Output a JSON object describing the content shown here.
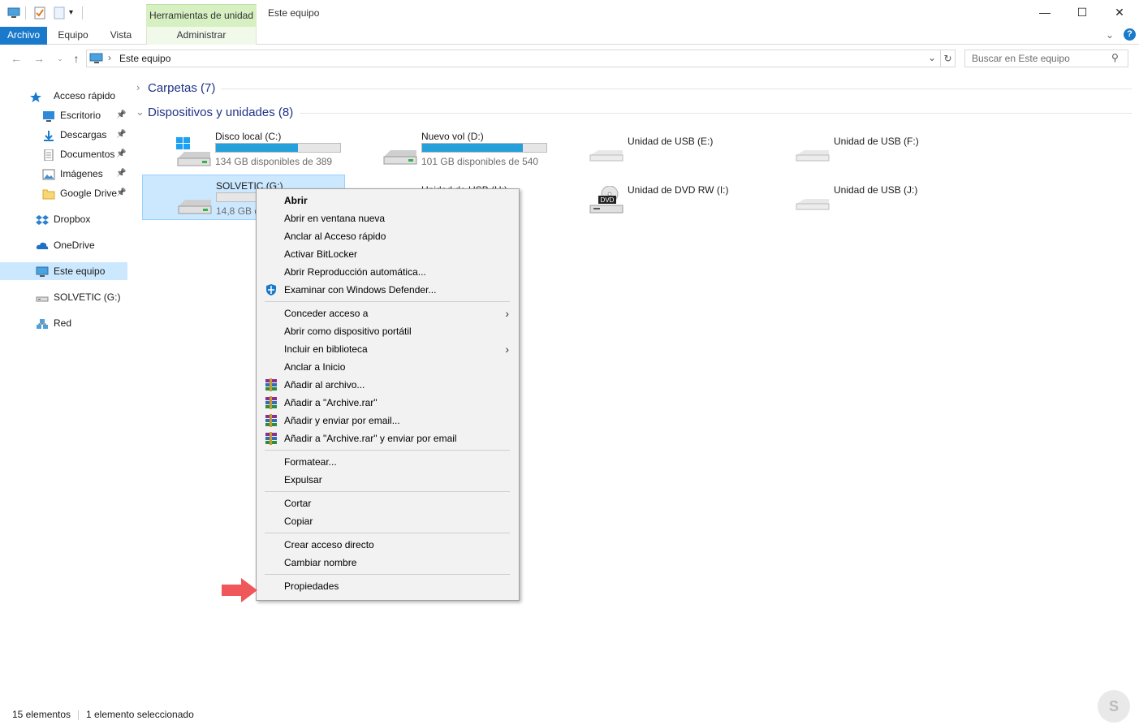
{
  "window": {
    "title": "Este equipo",
    "contextual_tab_group": "Herramientas de unidad",
    "controls": {
      "minimize": "—",
      "maximize": "☐",
      "close": "✕"
    }
  },
  "ribbon": {
    "tabs": [
      "Archivo",
      "Equipo",
      "Vista"
    ],
    "contextual_tab": "Administrar"
  },
  "address_bar": {
    "location": "Este equipo",
    "search_placeholder": "Buscar en Este equipo"
  },
  "nav_pane": {
    "items": [
      {
        "label": "Acceso rápido",
        "icon": "star-icon"
      },
      {
        "label": "Escritorio",
        "icon": "desktop-icon",
        "pinned": true
      },
      {
        "label": "Descargas",
        "icon": "download-icon",
        "pinned": true
      },
      {
        "label": "Documentos",
        "icon": "documents-icon",
        "pinned": true
      },
      {
        "label": "Imágenes",
        "icon": "images-icon",
        "pinned": true
      },
      {
        "label": "Google Drive",
        "icon": "folder-icon",
        "pinned": true
      },
      {
        "label": "Dropbox",
        "icon": "dropbox-icon"
      },
      {
        "label": "OneDrive",
        "icon": "cloud-icon"
      },
      {
        "label": "Este equipo",
        "icon": "computer-icon",
        "selected": true
      },
      {
        "label": "SOLVETIC (G:)",
        "icon": "usb-drive-icon"
      },
      {
        "label": "Red",
        "icon": "network-icon"
      }
    ]
  },
  "content": {
    "groups": [
      {
        "title": "Carpetas (7)",
        "expanded": false
      },
      {
        "title": "Dispositivos y unidades (8)",
        "expanded": true
      }
    ],
    "drives": [
      {
        "name": "Disco local (C:)",
        "free": "134 GB disponibles de 389",
        "used_fraction": 0.66,
        "icon": "windows-drive-icon"
      },
      {
        "name": "Nuevo vol (D:)",
        "free": "101 GB disponibles de 540",
        "used_fraction": 0.81,
        "icon": "hard-drive-icon"
      },
      {
        "name": "Unidad de USB (E:)",
        "icon": "usb-drive-icon"
      },
      {
        "name": "Unidad de USB (F:)",
        "icon": "usb-drive-icon"
      },
      {
        "name": "SOLVETIC (G:)",
        "free": "14,8 GB d",
        "used_fraction": 0.0,
        "icon": "hard-drive-icon",
        "selected": true
      },
      {
        "name": "Unidad de USB (H:)",
        "icon": "usb-drive-icon"
      },
      {
        "name": "Unidad de DVD RW (I:)",
        "icon": "dvd-drive-icon",
        "badge": "DVD"
      },
      {
        "name": "Unidad de USB (J:)",
        "icon": "usb-drive-icon"
      }
    ]
  },
  "context_menu": {
    "items": [
      {
        "label": "Abrir",
        "bold": true
      },
      {
        "label": "Abrir en ventana nueva"
      },
      {
        "label": "Anclar al Acceso rápido"
      },
      {
        "label": "Activar BitLocker"
      },
      {
        "label": "Abrir Reproducción automática..."
      },
      {
        "label": "Examinar con Windows Defender...",
        "icon": "defender-icon"
      },
      {
        "sep": true
      },
      {
        "label": "Conceder acceso a",
        "submenu": true
      },
      {
        "label": "Abrir como dispositivo portátil"
      },
      {
        "label": "Incluir en biblioteca",
        "submenu": true
      },
      {
        "label": "Anclar a Inicio"
      },
      {
        "label": "Añadir al archivo...",
        "icon": "winrar-icon"
      },
      {
        "label": "Añadir a \"Archive.rar\"",
        "icon": "winrar-icon"
      },
      {
        "label": "Añadir y enviar por email...",
        "icon": "winrar-icon"
      },
      {
        "label": "Añadir a \"Archive.rar\" y enviar por email",
        "icon": "winrar-icon"
      },
      {
        "sep": true
      },
      {
        "label": "Formatear..."
      },
      {
        "label": "Expulsar"
      },
      {
        "sep": true
      },
      {
        "label": "Cortar"
      },
      {
        "label": "Copiar"
      },
      {
        "sep": true
      },
      {
        "label": "Crear acceso directo"
      },
      {
        "label": "Cambiar nombre"
      },
      {
        "sep": true
      },
      {
        "label": "Propiedades"
      }
    ]
  },
  "status_bar": {
    "count": "15 elementos",
    "selection": "1 elemento seleccionado"
  },
  "colors": {
    "accent": "#1979ca",
    "selection": "#cce8ff",
    "bar_fill": "#26a0da",
    "arrow": "#f0575a",
    "contextual_tab": "#d6f0c2"
  }
}
